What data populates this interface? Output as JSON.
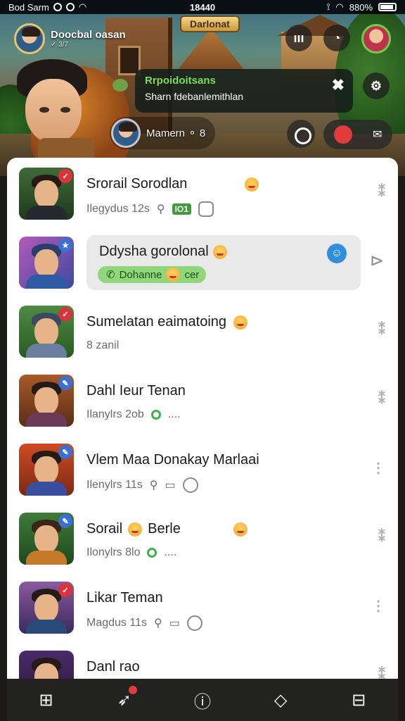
{
  "status_bar": {
    "carrier": "Bod Sarm",
    "time": "18440",
    "battery": "880%"
  },
  "header": {
    "profile_name": "Doocbal oasan",
    "profile_sub": "✓ 3/7",
    "banner": "Darlonat",
    "notification_title": "Rrpoidoitsans",
    "notification_text": "Sharn fdebanlemithlan",
    "player_name": "Mamern ⚬ 8",
    "colors": {
      "accent_green": "#7fdc54",
      "panel_bg": "#ffffff",
      "nav_bg": "#222220"
    }
  },
  "chats": [
    {
      "name": "Srorail Sorodlan",
      "meta": "Ilegydus 12s",
      "tag": "IO1",
      "badge": "red",
      "has_emoji": true
    },
    {
      "name": "Ddysha gorolonal",
      "pill": "Dohanne",
      "pill_suffix": "cer",
      "badge": "blue",
      "highlighted": true
    },
    {
      "name": "Sumelatan eaimatoing",
      "meta": "8 zanil",
      "badge": "red",
      "has_emoji": true
    },
    {
      "name": "Dahl Ieur Tenan",
      "meta": "Ilanylrs 2ob",
      "more": "....",
      "badge": "blue"
    },
    {
      "name": "Vlem Maa Donakay Marlaai",
      "meta": "Ilenylrs 11s",
      "badge": "blue"
    },
    {
      "name": "Sorail",
      "name_suffix": "Berle",
      "meta": "Ilonylrs 8lo",
      "more": "....",
      "badge": "blue",
      "has_emoji": true
    },
    {
      "name": "Likar Teman",
      "meta": "Magdus 11s",
      "badge": "red"
    },
    {
      "name": "Danl rao",
      "badge": "none"
    }
  ],
  "bottom_nav": [
    {
      "icon": "grid-icon"
    },
    {
      "icon": "bird-icon",
      "notification": true
    },
    {
      "icon": "info-icon"
    },
    {
      "icon": "chat-bubble-icon"
    },
    {
      "icon": "briefcase-icon"
    }
  ]
}
